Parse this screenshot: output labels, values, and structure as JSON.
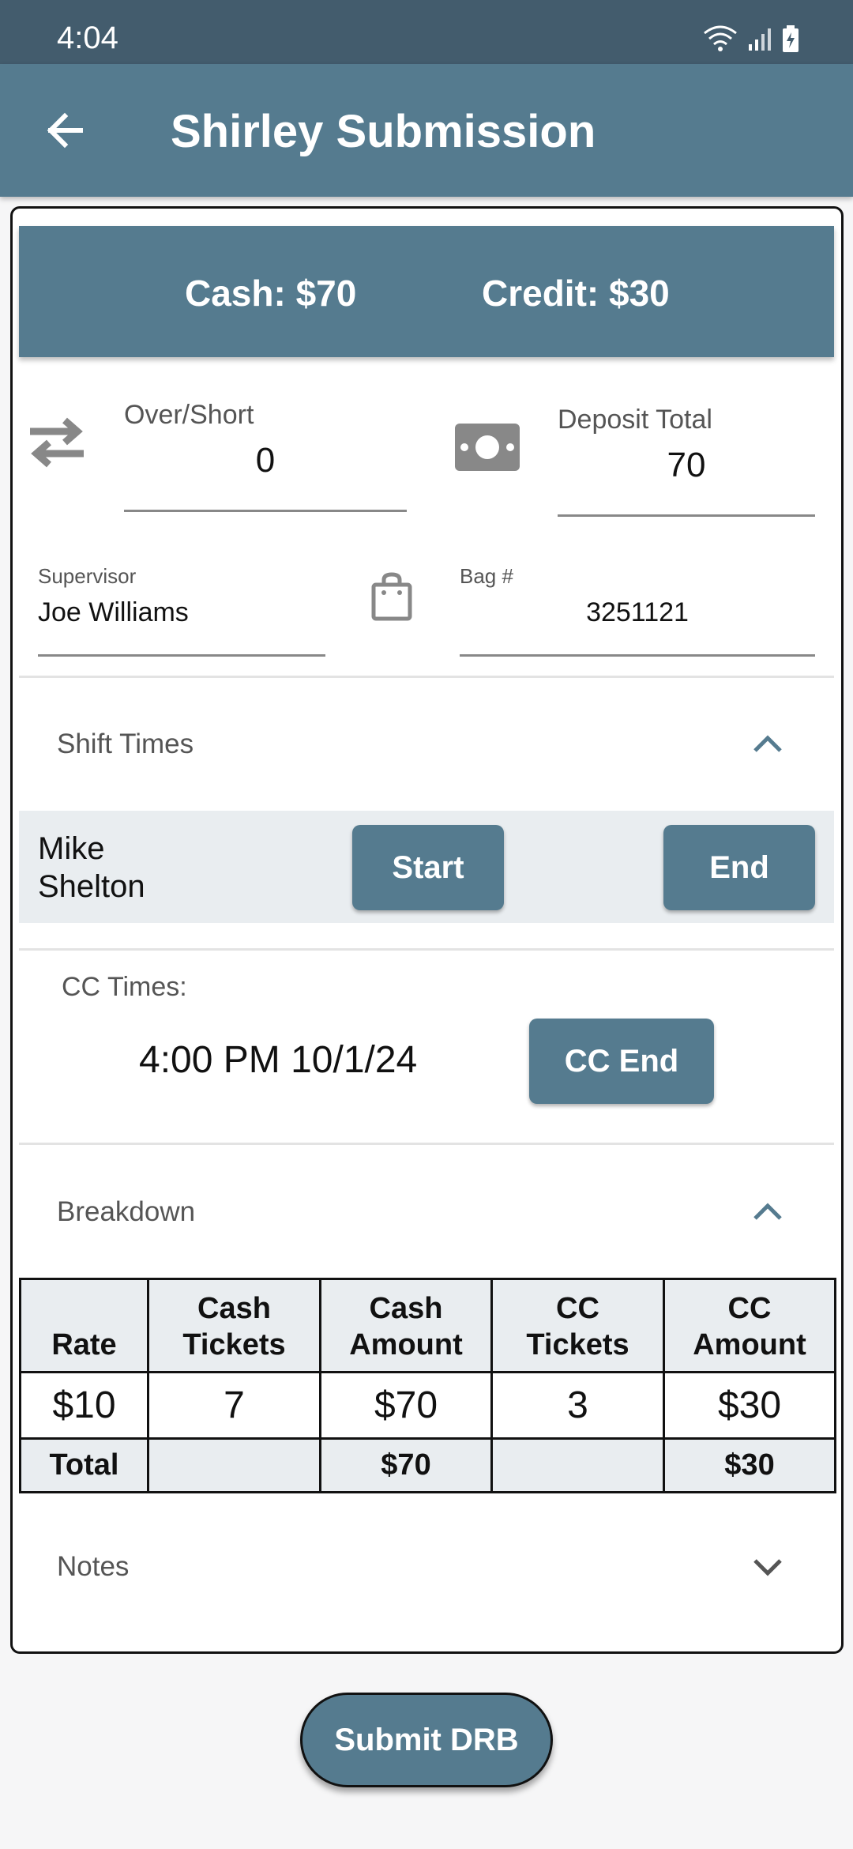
{
  "status_bar": {
    "time": "4:04"
  },
  "app_bar": {
    "title": "Shirley Submission"
  },
  "summary": {
    "cash": "Cash: $70",
    "credit": "Credit: $30"
  },
  "over_short": {
    "label": "Over/Short",
    "value": "0"
  },
  "deposit_total": {
    "label": "Deposit Total",
    "value": "70"
  },
  "supervisor": {
    "label": "Supervisor",
    "value": "Joe Williams"
  },
  "bag": {
    "label": "Bag #",
    "value": "3251121"
  },
  "shift_times": {
    "title": "Shift Times",
    "employee_first": "Mike",
    "employee_last": "Shelton",
    "start_label": "Start",
    "end_label": "End"
  },
  "cc_times": {
    "label": "CC Times:",
    "value": "4:00 PM 10/1/24",
    "button_label": "CC End"
  },
  "breakdown": {
    "title": "Breakdown",
    "headers": [
      {
        "line1": "",
        "line2": "Rate"
      },
      {
        "line1": "Cash",
        "line2": "Tickets"
      },
      {
        "line1": "Cash",
        "line2": "Amount"
      },
      {
        "line1": "CC",
        "line2": "Tickets"
      },
      {
        "line1": "CC",
        "line2": "Amount"
      }
    ],
    "rows": [
      [
        "$10",
        "7",
        "$70",
        "3",
        "$30"
      ]
    ],
    "totals": [
      "Total",
      "",
      "$70",
      "",
      "$30"
    ]
  },
  "notes": {
    "title": "Notes"
  },
  "submit": {
    "label": "Submit DRB"
  },
  "colors": {
    "primary": "#557b8f",
    "status_bar": "#435c6d",
    "row_bg": "#e9edf0"
  }
}
